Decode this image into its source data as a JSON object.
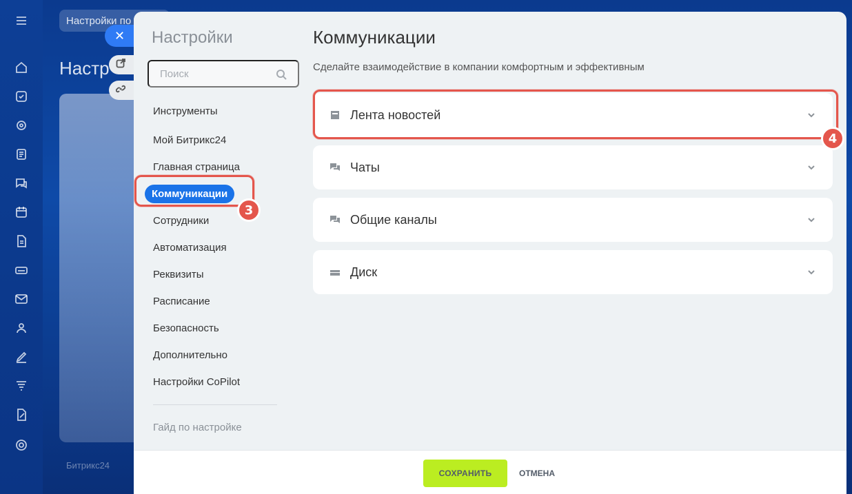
{
  "background": {
    "tab_text": "Настройки по",
    "page_title": "Настр",
    "footer_text": "Битрикс24"
  },
  "rail": {
    "icons": [
      "menu-icon",
      "home-icon",
      "tasks-icon",
      "crm-icon",
      "feed-icon",
      "chat-icon",
      "calendar-icon",
      "docs-icon",
      "drive-icon",
      "mail-icon",
      "people-icon",
      "sign-icon",
      "filter-icon",
      "reports-icon",
      "settings-icon"
    ]
  },
  "sidebar_buttons": {
    "close": "✕"
  },
  "nav": {
    "title": "Настройки",
    "search_placeholder": "Поиск",
    "items": [
      {
        "label": "Инструменты"
      },
      {
        "label": "Мой Битрикс24"
      },
      {
        "label": "Главная страница"
      },
      {
        "label": "Коммуникации"
      },
      {
        "label": "Сотрудники"
      },
      {
        "label": "Автоматизация"
      },
      {
        "label": "Реквизиты"
      },
      {
        "label": "Расписание"
      },
      {
        "label": "Безопасность"
      },
      {
        "label": "Дополнительно"
      },
      {
        "label": "Настройки CoPilot"
      }
    ],
    "active_index": 3,
    "guide": "Гайд по настройке"
  },
  "content": {
    "title": "Коммуникации",
    "description": "Сделайте взаимодействие в компании комфортным и эффективным",
    "sections": [
      {
        "label": "Лента новостей",
        "icon": "feed-icon"
      },
      {
        "label": "Чаты",
        "icon": "chat-icon"
      },
      {
        "label": "Общие каналы",
        "icon": "chat-icon"
      },
      {
        "label": "Диск",
        "icon": "drive-icon"
      }
    ]
  },
  "annotations": {
    "badge_nav": "3",
    "badge_section": "4",
    "color": "#e4564c"
  },
  "footer": {
    "save_label": "СОХРАНИТЬ",
    "cancel_label": "ОТМЕНА"
  },
  "colors": {
    "accent": "#1a73e8",
    "save": "#bbed21"
  }
}
